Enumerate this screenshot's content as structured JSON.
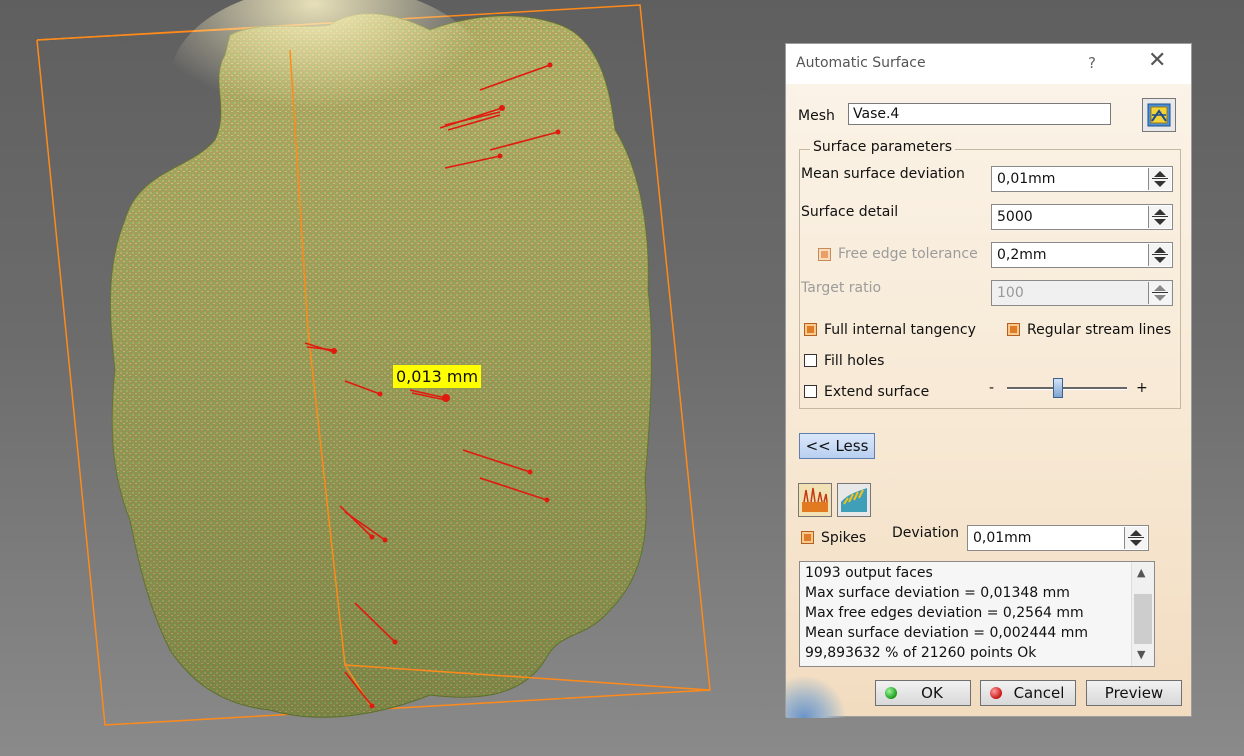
{
  "viewport": {
    "annotation": "0,013 mm",
    "mesh_color": "#a88f5e",
    "highlight_color": "#fff2b8",
    "point_color": "#3ddc3d",
    "bbox_color": "#ff8a1a",
    "spike_color": "#e11a10"
  },
  "dialog": {
    "title": "Automatic Surface",
    "help": "?",
    "close": "✕",
    "mesh_label": "Mesh",
    "mesh_value": "Vase.4",
    "group_title": "Surface parameters",
    "mean_dev_label": "Mean surface deviation",
    "mean_dev_value": "0,01mm",
    "detail_label": "Surface detail",
    "detail_value": "5000",
    "free_edge_label": "Free edge tolerance",
    "free_edge_value": "0,2mm",
    "target_label": "Target ratio",
    "target_value": "100",
    "full_tangency_label": "Full internal tangency",
    "stream_lines_label": "Regular stream lines",
    "fill_holes_label": "Fill holes",
    "extend_label": "Extend surface",
    "slider_minus": "-",
    "slider_plus": "+",
    "less_button": "<< Less",
    "spikes_label": "Spikes",
    "deviation_label": "Deviation",
    "deviation_value": "0,01mm",
    "output_lines": [
      "1093 output faces",
      "Max surface deviation = 0,01348 mm",
      "Max free edges deviation = 0,2564 mm",
      "Mean surface deviation = 0,002444 mm",
      "99,893632 % of 21260 points Ok"
    ],
    "ok": "OK",
    "cancel": "Cancel",
    "preview": "Preview"
  }
}
